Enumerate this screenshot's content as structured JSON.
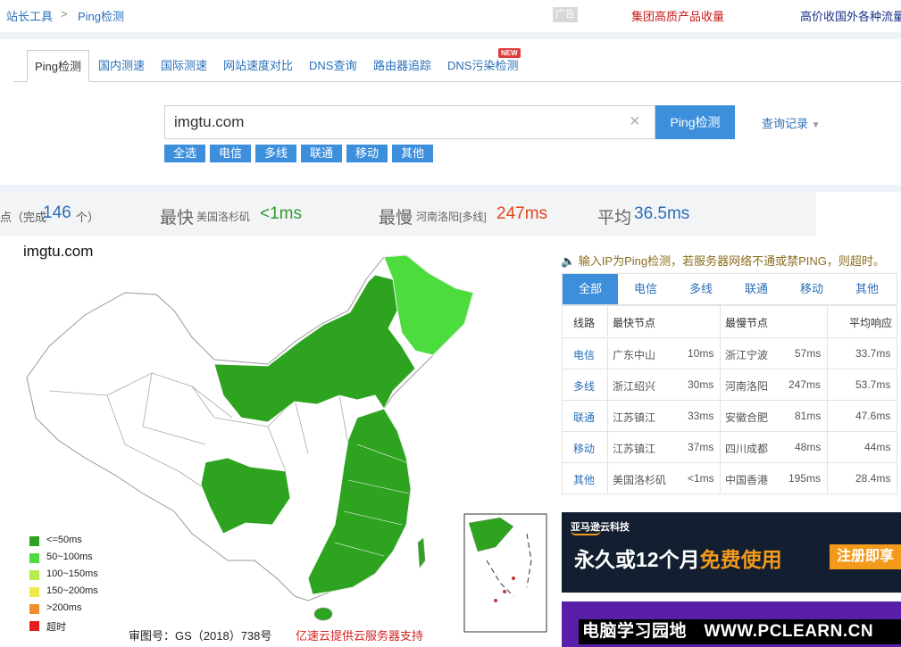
{
  "breadcrumb": {
    "home": "站长工具",
    "separator": ">",
    "current": "Ping检测"
  },
  "top_ads": {
    "tag": "广告",
    "ad1": "集团高质产品收量",
    "ad2": "高价收国外各种流量"
  },
  "tabs": [
    {
      "label": "Ping检测",
      "active": true
    },
    {
      "label": "国内测速"
    },
    {
      "label": "国际测速"
    },
    {
      "label": "网站速度对比"
    },
    {
      "label": "DNS查询"
    },
    {
      "label": "路由器追踪"
    },
    {
      "label": "DNS污染检测",
      "badge": "NEW"
    }
  ],
  "search": {
    "value": "imgtu.com",
    "button": "Ping检测",
    "history": "查询记录",
    "clear_icon": "×"
  },
  "filters": [
    "全选",
    "电信",
    "多线",
    "联通",
    "移动",
    "其他"
  ],
  "stats": {
    "done_prefix": "点（完成",
    "done_count": "146",
    "done_suffix": "个）",
    "fastest_label": "最快",
    "fastest_node": "美国洛杉矶",
    "fastest_value": "<1ms",
    "slowest_label": "最慢",
    "slowest_node": "河南洛阳[多线]",
    "slowest_value": "247ms",
    "avg_label": "平均",
    "avg_value": "36.5ms"
  },
  "map": {
    "title": "imgtu.com",
    "legend": [
      {
        "label": "<=50ms",
        "color": "#2ea31f"
      },
      {
        "label": "50~100ms",
        "color": "#4ddc3e"
      },
      {
        "label": "100~150ms",
        "color": "#b4ec4c"
      },
      {
        "label": "150~200ms",
        "color": "#eee84a"
      },
      {
        "label": ">200ms",
        "color": "#f08d2e"
      },
      {
        "label": "超时",
        "color": "#e41c1c"
      }
    ],
    "map_no": "审图号：GS（2018）738号",
    "credit": "亿速云提供云服务器支持"
  },
  "notice": "输入IP为Ping检测，若服务器网络不通或禁PING，则超时。",
  "result_tabs": [
    "全部",
    "电信",
    "多线",
    "联通",
    "移动",
    "其他"
  ],
  "result_table": {
    "headers": [
      "线路",
      "最快节点",
      "最慢节点",
      "平均响应"
    ],
    "rows": [
      {
        "line": "电信",
        "fast_node": "广东中山",
        "fast_ms": "10ms",
        "slow_node": "浙江宁波",
        "slow_ms": "57ms",
        "avg": "33.7ms"
      },
      {
        "line": "多线",
        "fast_node": "浙江绍兴",
        "fast_ms": "30ms",
        "slow_node": "河南洛阳",
        "slow_ms": "247ms",
        "avg": "53.7ms"
      },
      {
        "line": "联通",
        "fast_node": "江苏镇江",
        "fast_ms": "33ms",
        "slow_node": "安徽合肥",
        "slow_ms": "81ms",
        "avg": "47.6ms"
      },
      {
        "line": "移动",
        "fast_node": "江苏镇江",
        "fast_ms": "37ms",
        "slow_node": "四川成都",
        "slow_ms": "48ms",
        "avg": "44ms"
      },
      {
        "line": "其他",
        "fast_node": "美国洛杉矶",
        "fast_ms": "<1ms",
        "slow_node": "中国香港",
        "slow_ms": "195ms",
        "avg": "28.4ms"
      }
    ]
  },
  "aws_ad": {
    "brand": "亚马逊云科技",
    "headline_a": "永久或12个月",
    "headline_b": "免费使用",
    "cta": "注册即享"
  },
  "watermark": "电脑学习园地　WWW.PCLEARN.CN",
  "colors": {
    "accent": "#3d8fdc",
    "link": "#2a6fb8",
    "slow": "#e0461c",
    "fast": "#2e9a2e"
  }
}
